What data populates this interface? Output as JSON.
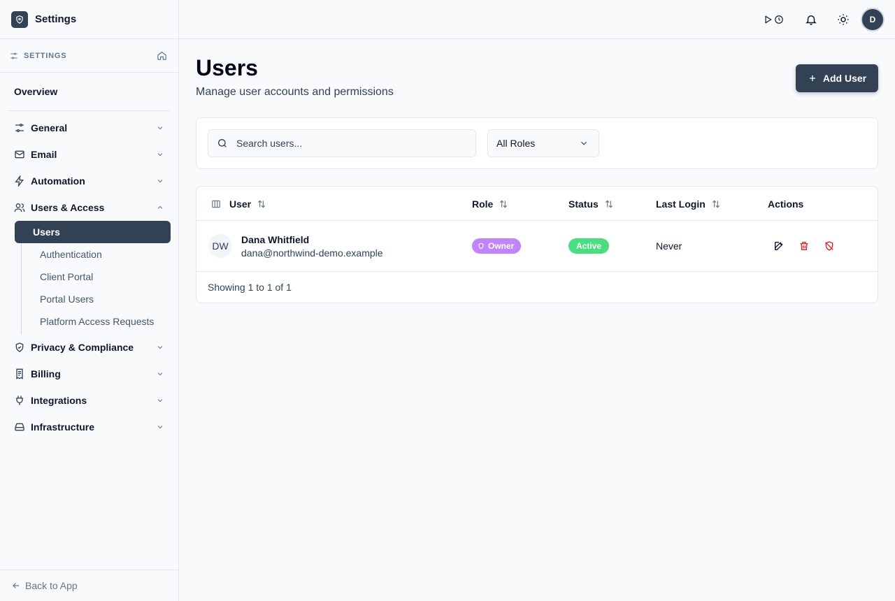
{
  "app": {
    "title": "Settings"
  },
  "sidebar": {
    "section_label": "SETTINGS",
    "overview_label": "Overview",
    "items": [
      {
        "label": "General",
        "icon": "sliders-icon"
      },
      {
        "label": "Email",
        "icon": "mail-icon"
      },
      {
        "label": "Automation",
        "icon": "bolt-icon"
      },
      {
        "label": "Users & Access",
        "icon": "users-icon",
        "expanded": true,
        "children": [
          {
            "label": "Users",
            "active": true
          },
          {
            "label": "Authentication"
          },
          {
            "label": "Client Portal"
          },
          {
            "label": "Portal Users"
          },
          {
            "label": "Platform Access Requests"
          }
        ]
      },
      {
        "label": "Privacy & Compliance",
        "icon": "shield-check-icon"
      },
      {
        "label": "Billing",
        "icon": "receipt-icon"
      },
      {
        "label": "Integrations",
        "icon": "plug-icon"
      },
      {
        "label": "Infrastructure",
        "icon": "hard-drive-icon"
      }
    ],
    "back_label": "Back to App"
  },
  "topbar": {
    "avatar_initial": "D"
  },
  "page": {
    "title": "Users",
    "subtitle": "Manage user accounts and permissions",
    "add_button_label": "Add User"
  },
  "filters": {
    "search_placeholder": "Search users...",
    "role_select_value": "All Roles"
  },
  "table": {
    "columns": [
      "User",
      "Role",
      "Status",
      "Last Login",
      "Actions"
    ],
    "rows": [
      {
        "initials": "DW",
        "name": "Dana Whitfield",
        "email": "dana@northwind-demo.example",
        "role": "Owner",
        "status": "Active",
        "last_login": "Never"
      }
    ],
    "footer": "Showing 1 to 1 of 1"
  },
  "colors": {
    "primary": "#334155",
    "role_owner": "#c084fc",
    "status_active": "#4ade80",
    "danger": "#dc2626"
  }
}
